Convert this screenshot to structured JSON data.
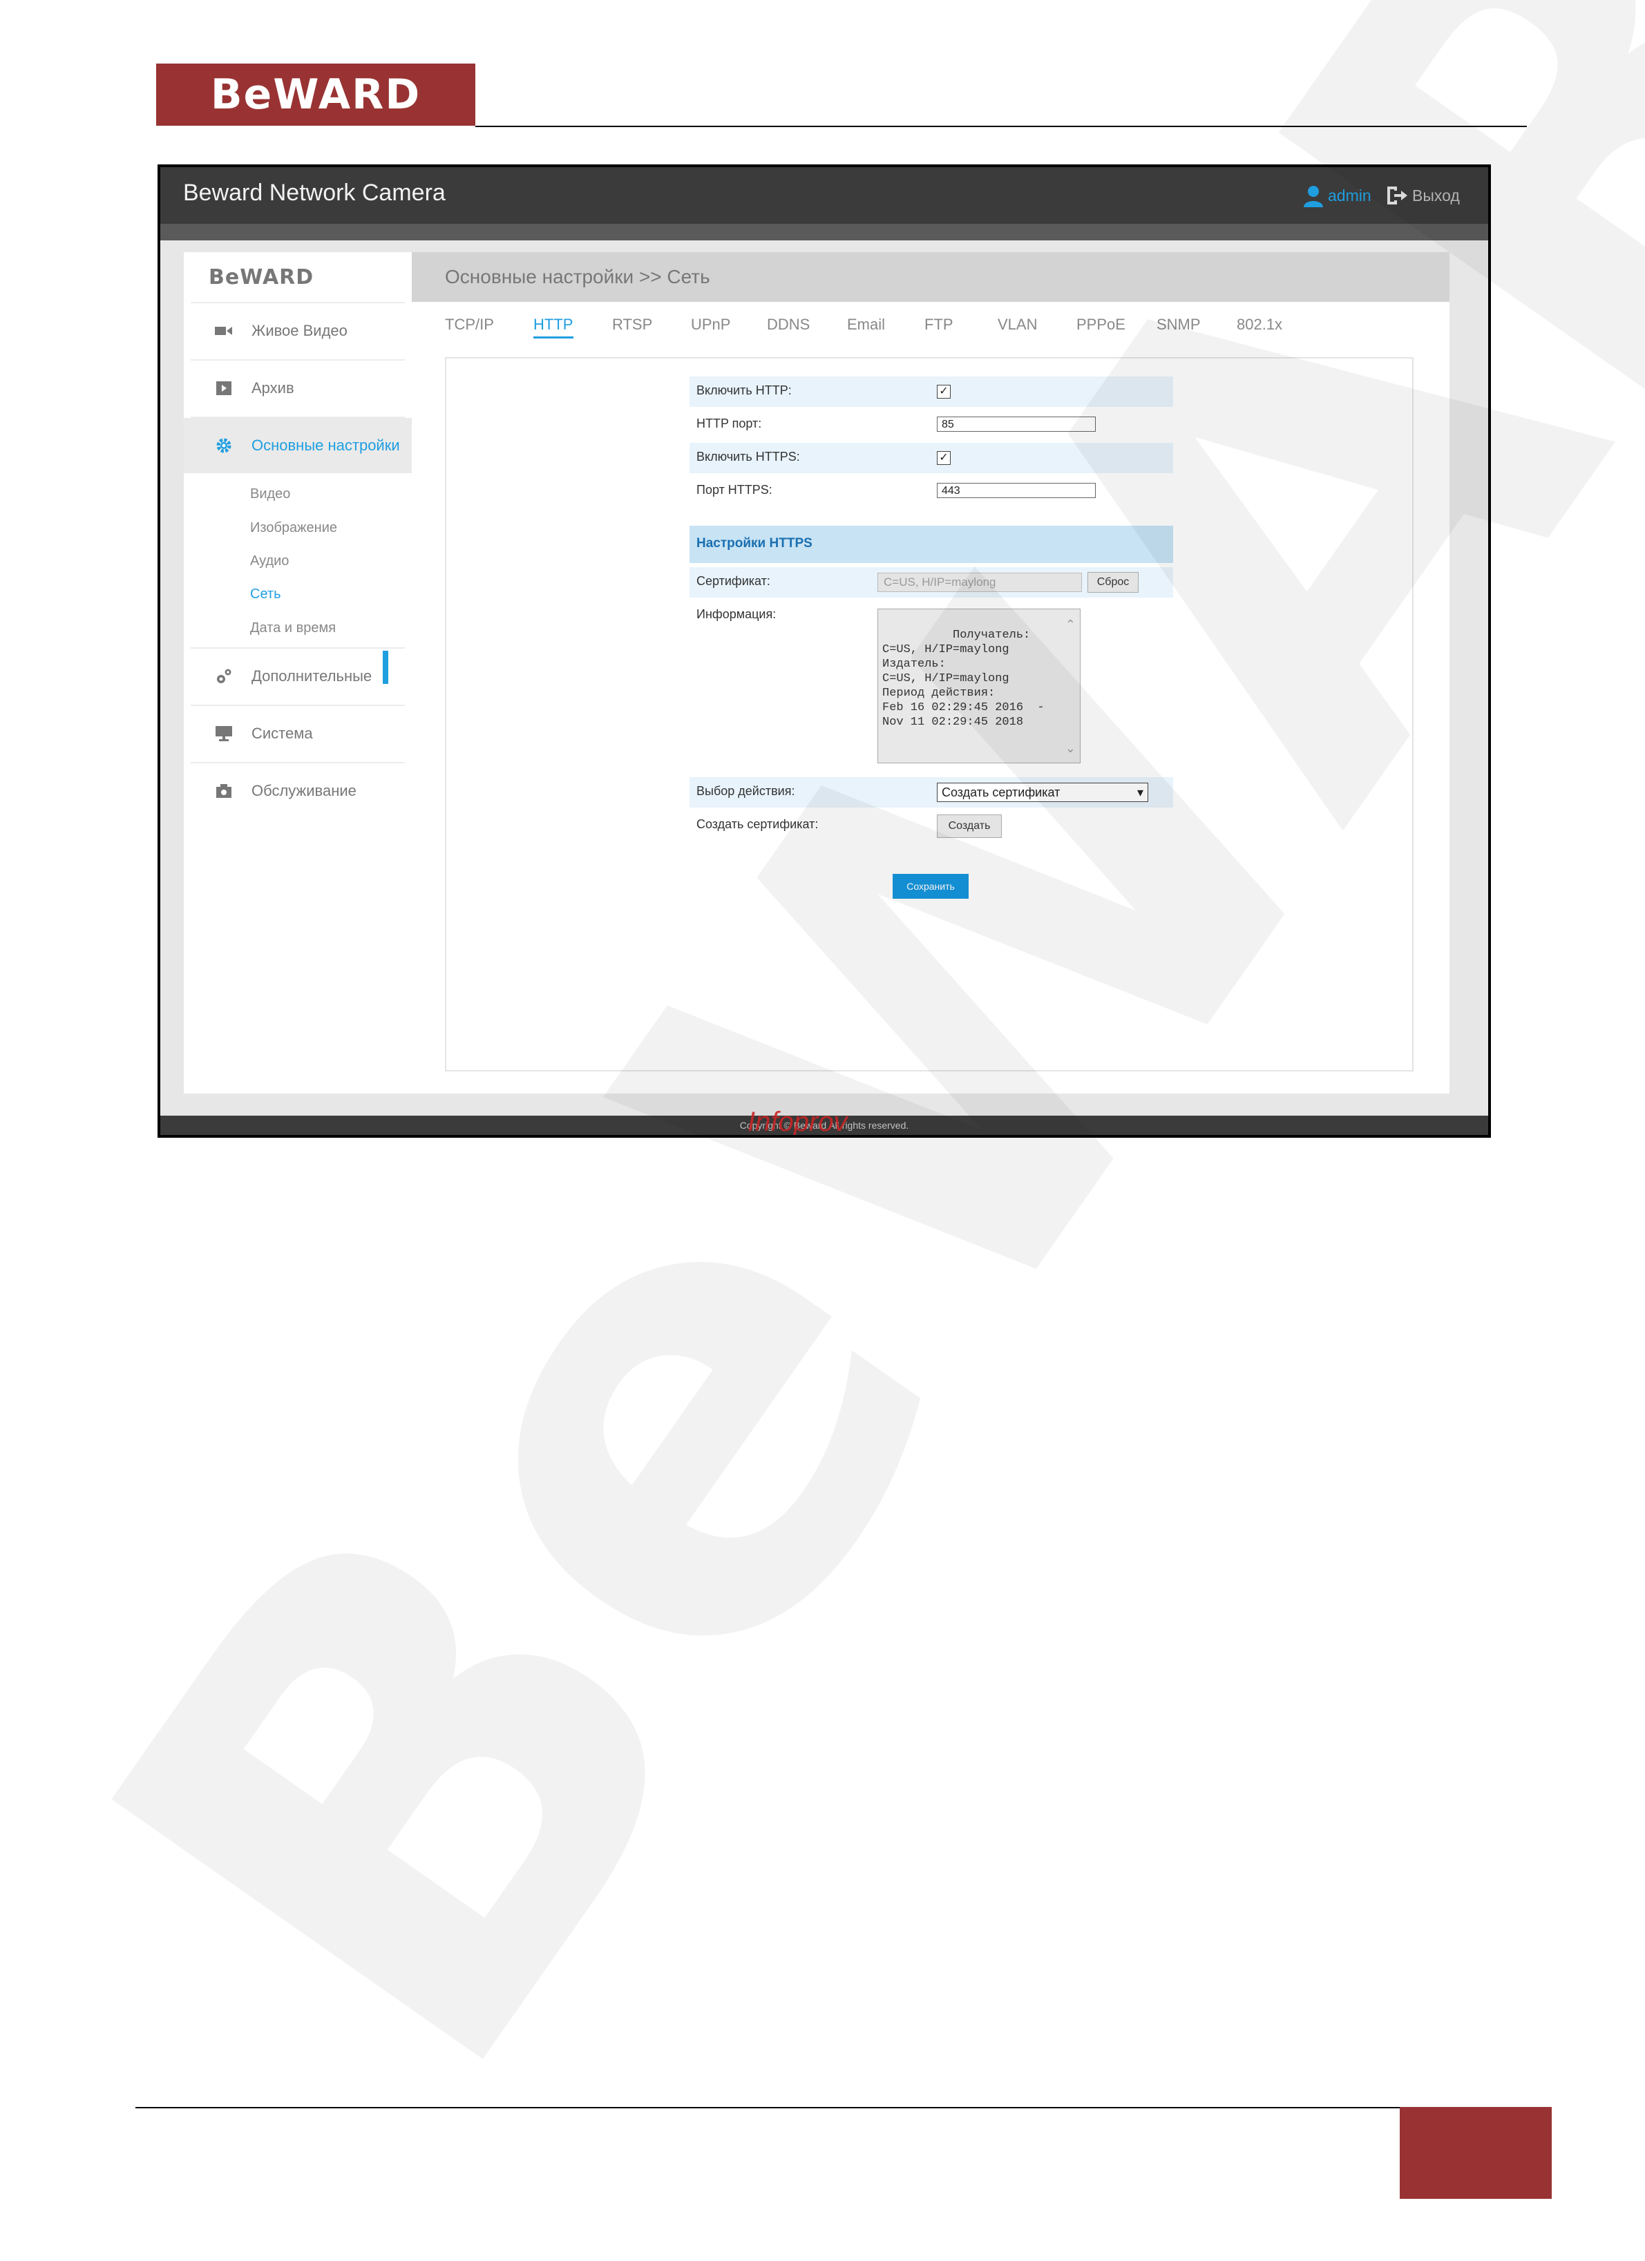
{
  "document": {
    "logo_text": "BeWARD"
  },
  "app": {
    "title": "Beward Network Camera",
    "user": "admin",
    "logout_label": "Выход",
    "copyright": "Copyright © Beward All rights reserved.",
    "copyright_overlay": "Infoprov"
  },
  "sidebar": {
    "logo_text": "BeWARD",
    "items": [
      {
        "label": "Живое Видео",
        "icon": "video-camera-icon"
      },
      {
        "label": "Архив",
        "icon": "play-icon"
      },
      {
        "label": "Основные настройки",
        "icon": "gear-icon"
      },
      {
        "label": "Дополнительные",
        "icon": "gears-icon"
      },
      {
        "label": "Система",
        "icon": "monitor-icon"
      },
      {
        "label": "Обслуживание",
        "icon": "camera-icon"
      }
    ],
    "subitems": [
      "Видео",
      "Изображение",
      "Аудио",
      "Сеть",
      "Дата и время"
    ],
    "active_item": "Основные настройки",
    "active_subitem": "Сеть"
  },
  "main": {
    "breadcrumb": "Основные настройки >> Сеть",
    "tabs": [
      "TCP/IP",
      "HTTP",
      "RTSP",
      "UPnP",
      "DDNS",
      "Email",
      "FTP",
      "VLAN",
      "PPPoE",
      "SNMP",
      "802.1x"
    ],
    "active_tab": "HTTP"
  },
  "form": {
    "enable_http_label": "Включить HTTP:",
    "enable_http_checked": true,
    "http_port_label": "HTTP порт:",
    "http_port_value": "85",
    "enable_https_label": "Включить HTTPS:",
    "enable_https_checked": true,
    "https_port_label": "Порт HTTPS:",
    "https_port_value": "443",
    "https_section_title": "Настройки HTTPS",
    "certificate_label": "Сертификат:",
    "certificate_value": "C=US, H/IP=maylong",
    "reset_button": "Сброс",
    "info_label": "Информация:",
    "info_text": "Получатель:\nC=US, H/IP=maylong\nИздатель:\nC=US, H/IP=maylong\nПериод действия:\nFeb 16 02:29:45 2016  -\nNov 11 02:29:45 2018",
    "action_label": "Выбор действия:",
    "action_value": "Создать сертификат",
    "create_cert_label": "Создать сертификат:",
    "create_button": "Создать",
    "save_button": "Сохранить"
  },
  "colors": {
    "brand": "#993333",
    "accent": "#1f9ee0",
    "topbar": "#3b3b3b"
  }
}
